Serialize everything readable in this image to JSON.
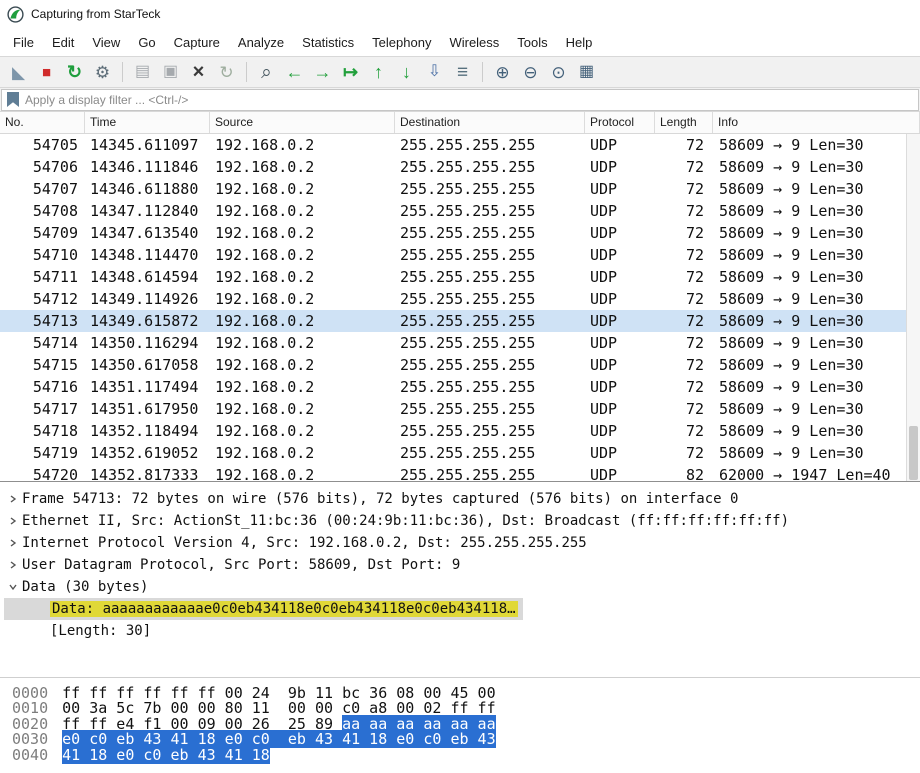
{
  "colors": {
    "selected_row": "#cfe2f5",
    "field_highlight": "#e0d837",
    "hex_selection": "#2a6fd2",
    "detail_selected_bg": "#d9d9d9"
  },
  "window": {
    "title": "Capturing from StarTeck"
  },
  "menu": {
    "items": [
      "File",
      "Edit",
      "View",
      "Go",
      "Capture",
      "Analyze",
      "Statistics",
      "Telephony",
      "Wireless",
      "Tools",
      "Help"
    ]
  },
  "toolbar": {
    "groups": [
      [
        {
          "name": "start-capture-icon",
          "glyph": "◣",
          "color": "#7e96aa",
          "size": 17
        },
        {
          "name": "stop-capture-icon",
          "glyph": "■",
          "color": "#d02b2b",
          "size": 15
        },
        {
          "name": "restart-capture-icon",
          "glyph": "↻",
          "color": "#1f9e3d",
          "size": 18,
          "bold": true
        },
        {
          "name": "capture-options-icon",
          "glyph": "⚙",
          "color": "#5d6d78",
          "size": 17
        }
      ],
      [
        {
          "name": "open-file-icon",
          "glyph": "▤",
          "color": "#a6aaae",
          "size": 16
        },
        {
          "name": "save-file-icon",
          "glyph": "▣",
          "color": "#a6aaae",
          "size": 16
        },
        {
          "name": "close-file-icon",
          "glyph": "×",
          "color": "#3a3a3a",
          "size": 20,
          "bold": true
        },
        {
          "name": "reload-icon",
          "glyph": "↻",
          "color": "#9fae9f",
          "size": 17
        }
      ],
      [
        {
          "name": "find-packet-icon",
          "glyph": "⌕",
          "color": "#46565f",
          "size": 19
        },
        {
          "name": "go-back-icon",
          "glyph": "←",
          "color": "#22a03c",
          "size": 18,
          "bold": true
        },
        {
          "name": "go-forward-icon",
          "glyph": "→",
          "color": "#22a03c",
          "size": 18,
          "bold": true
        },
        {
          "name": "go-to-packet-icon",
          "glyph": "↦",
          "color": "#22a03c",
          "size": 18,
          "bold": true
        },
        {
          "name": "go-to-top-icon",
          "glyph": "↑",
          "color": "#22a03c",
          "size": 18,
          "bold": true
        },
        {
          "name": "go-to-bottom-icon",
          "glyph": "↓",
          "color": "#22a03c",
          "size": 18,
          "bold": true
        },
        {
          "name": "auto-scroll-icon",
          "glyph": "⇩",
          "color": "#4a6fa5",
          "size": 16
        },
        {
          "name": "colorize-icon",
          "glyph": "≡",
          "color": "#57707e",
          "size": 19
        }
      ],
      [
        {
          "name": "zoom-in-icon",
          "glyph": "⊕",
          "color": "#44617a",
          "size": 17
        },
        {
          "name": "zoom-out-icon",
          "glyph": "⊖",
          "color": "#44617a",
          "size": 17
        },
        {
          "name": "zoom-original-icon",
          "glyph": "⊙",
          "color": "#44617a",
          "size": 17
        },
        {
          "name": "resize-columns-icon",
          "glyph": "▦",
          "color": "#44617a",
          "size": 16
        }
      ]
    ]
  },
  "filter_bar": {
    "placeholder": "Apply a display filter ... <Ctrl-/>"
  },
  "packet_list": {
    "columns": [
      {
        "key": "no",
        "label": "No."
      },
      {
        "key": "time",
        "label": "Time"
      },
      {
        "key": "source",
        "label": "Source"
      },
      {
        "key": "destination",
        "label": "Destination"
      },
      {
        "key": "protocol",
        "label": "Protocol"
      },
      {
        "key": "length",
        "label": "Length"
      },
      {
        "key": "info",
        "label": "Info"
      }
    ],
    "rows": [
      {
        "no": "54705",
        "time": "14345.611097",
        "source": "192.168.0.2",
        "destination": "255.255.255.255",
        "protocol": "UDP",
        "length": "72",
        "info": "58609 → 9 Len=30",
        "selected": false
      },
      {
        "no": "54706",
        "time": "14346.111846",
        "source": "192.168.0.2",
        "destination": "255.255.255.255",
        "protocol": "UDP",
        "length": "72",
        "info": "58609 → 9 Len=30",
        "selected": false
      },
      {
        "no": "54707",
        "time": "14346.611880",
        "source": "192.168.0.2",
        "destination": "255.255.255.255",
        "protocol": "UDP",
        "length": "72",
        "info": "58609 → 9 Len=30",
        "selected": false
      },
      {
        "no": "54708",
        "time": "14347.112840",
        "source": "192.168.0.2",
        "destination": "255.255.255.255",
        "protocol": "UDP",
        "length": "72",
        "info": "58609 → 9 Len=30",
        "selected": false
      },
      {
        "no": "54709",
        "time": "14347.613540",
        "source": "192.168.0.2",
        "destination": "255.255.255.255",
        "protocol": "UDP",
        "length": "72",
        "info": "58609 → 9 Len=30",
        "selected": false
      },
      {
        "no": "54710",
        "time": "14348.114470",
        "source": "192.168.0.2",
        "destination": "255.255.255.255",
        "protocol": "UDP",
        "length": "72",
        "info": "58609 → 9 Len=30",
        "selected": false
      },
      {
        "no": "54711",
        "time": "14348.614594",
        "source": "192.168.0.2",
        "destination": "255.255.255.255",
        "protocol": "UDP",
        "length": "72",
        "info": "58609 → 9 Len=30",
        "selected": false
      },
      {
        "no": "54712",
        "time": "14349.114926",
        "source": "192.168.0.2",
        "destination": "255.255.255.255",
        "protocol": "UDP",
        "length": "72",
        "info": "58609 → 9 Len=30",
        "selected": false
      },
      {
        "no": "54713",
        "time": "14349.615872",
        "source": "192.168.0.2",
        "destination": "255.255.255.255",
        "protocol": "UDP",
        "length": "72",
        "info": "58609 → 9 Len=30",
        "selected": true
      },
      {
        "no": "54714",
        "time": "14350.116294",
        "source": "192.168.0.2",
        "destination": "255.255.255.255",
        "protocol": "UDP",
        "length": "72",
        "info": "58609 → 9 Len=30",
        "selected": false
      },
      {
        "no": "54715",
        "time": "14350.617058",
        "source": "192.168.0.2",
        "destination": "255.255.255.255",
        "protocol": "UDP",
        "length": "72",
        "info": "58609 → 9 Len=30",
        "selected": false
      },
      {
        "no": "54716",
        "time": "14351.117494",
        "source": "192.168.0.2",
        "destination": "255.255.255.255",
        "protocol": "UDP",
        "length": "72",
        "info": "58609 → 9 Len=30",
        "selected": false
      },
      {
        "no": "54717",
        "time": "14351.617950",
        "source": "192.168.0.2",
        "destination": "255.255.255.255",
        "protocol": "UDP",
        "length": "72",
        "info": "58609 → 9 Len=30",
        "selected": false
      },
      {
        "no": "54718",
        "time": "14352.118494",
        "source": "192.168.0.2",
        "destination": "255.255.255.255",
        "protocol": "UDP",
        "length": "72",
        "info": "58609 → 9 Len=30",
        "selected": false
      },
      {
        "no": "54719",
        "time": "14352.619052",
        "source": "192.168.0.2",
        "destination": "255.255.255.255",
        "protocol": "UDP",
        "length": "72",
        "info": "58609 → 9 Len=30",
        "selected": false
      },
      {
        "no": "54720",
        "time": "14352.817333",
        "source": "192.168.0.2",
        "destination": "255.255.255.255",
        "protocol": "UDP",
        "length": "82",
        "info": "62000 → 1947 Len=40",
        "selected": false
      }
    ]
  },
  "details": {
    "lines": [
      {
        "id": "frame",
        "expander": "right",
        "indent": 0,
        "selected": false,
        "highlight": false,
        "text": "Frame 54713: 72 bytes on wire (576 bits), 72 bytes captured (576 bits) on interface 0"
      },
      {
        "id": "ethernet",
        "expander": "right",
        "indent": 0,
        "selected": false,
        "highlight": false,
        "text": "Ethernet II, Src: ActionSt_11:bc:36 (00:24:9b:11:bc:36), Dst: Broadcast (ff:ff:ff:ff:ff:ff)"
      },
      {
        "id": "ip",
        "expander": "right",
        "indent": 0,
        "selected": false,
        "highlight": false,
        "text": "Internet Protocol Version 4, Src: 192.168.0.2, Dst: 255.255.255.255"
      },
      {
        "id": "udp",
        "expander": "right",
        "indent": 0,
        "selected": false,
        "highlight": false,
        "text": "User Datagram Protocol, Src Port: 58609, Dst Port: 9"
      },
      {
        "id": "data-protocol",
        "expander": "down",
        "indent": 0,
        "selected": false,
        "highlight": false,
        "text": "Data (30 bytes)"
      },
      {
        "id": "data-field",
        "expander": "",
        "indent": 1,
        "selected": true,
        "highlight": true,
        "text": "Data: aaaaaaaaaaaae0c0eb434118e0c0eb434118e0c0eb434118…"
      },
      {
        "id": "data-length",
        "expander": "",
        "indent": 1,
        "selected": false,
        "highlight": false,
        "text": "[Length: 30]"
      }
    ]
  },
  "hex_view": {
    "lines": [
      {
        "offset": "0000",
        "pre": "ff ff ff ff ff ff 00 24  9b 11 bc 36 08 00 45 00",
        "sel": ""
      },
      {
        "offset": "0010",
        "pre": "00 3a 5c 7b 00 00 80 11  00 00 c0 a8 00 02 ff ff",
        "sel": ""
      },
      {
        "offset": "0020",
        "pre": "ff ff e4 f1 00 09 00 26  25 89 ",
        "sel": "aa aa aa aa aa aa"
      },
      {
        "offset": "0030",
        "pre": "",
        "sel": "e0 c0 eb 43 41 18 e0 c0  eb 43 41 18 e0 c0 eb 43"
      },
      {
        "offset": "0040",
        "pre": "",
        "sel": "41 18 e0 c0 eb 43 41 18"
      }
    ]
  }
}
